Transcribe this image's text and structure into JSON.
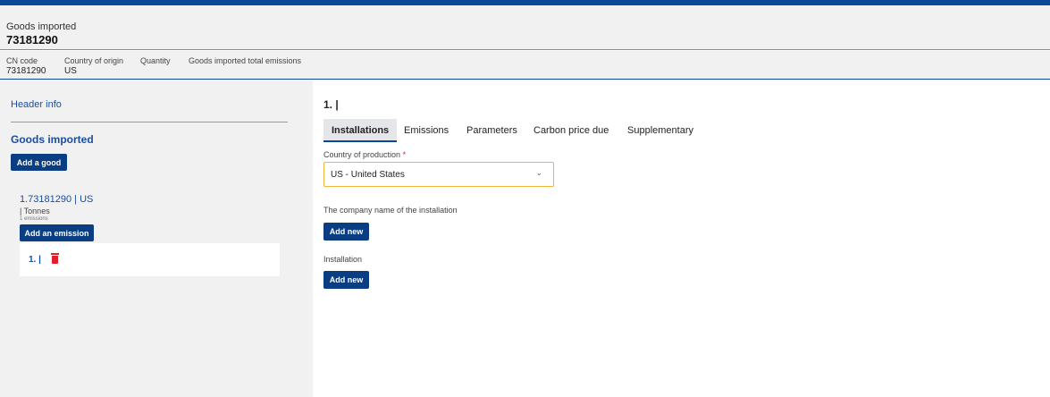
{
  "header": {
    "label": "Goods imported",
    "value": "73181290"
  },
  "summary": {
    "cn_code_label": "CN code",
    "cn_code_value": "73181290",
    "origin_label": "Country of origin",
    "origin_value": "US",
    "quantity_label": "Quantity",
    "total_emissions_label": "Goods imported total emissions"
  },
  "sidebar": {
    "header_info": "Header info",
    "goods_title": "Goods imported",
    "add_good": "Add a good",
    "good_item": {
      "name": "1.73181290 | US",
      "unit": "| Tonnes",
      "count": "1 emissions"
    },
    "add_emission": "Add an emission",
    "emission_item": {
      "label": "1. |"
    }
  },
  "main": {
    "title": "1. |",
    "tabs": [
      {
        "label": "Installations"
      },
      {
        "label": "Emissions"
      },
      {
        "label": "Parameters"
      },
      {
        "label": "Carbon price due"
      },
      {
        "label": "Supplementary"
      }
    ],
    "country_label": "Country of production",
    "required_mark": "*",
    "country_value": "US - United States",
    "chevron": "⌄",
    "company_label": "The company name of the installation",
    "add_new_1": "Add new",
    "installation_label": "Installation",
    "add_new_2": "Add new"
  },
  "colors": {
    "primary": "#0a4797",
    "button": "#0a3d82",
    "link": "#1a4ea0",
    "danger": "#e01e26",
    "focus": "#f0b43a"
  },
  "icons": {
    "delete": "trash-icon",
    "dropdown": "chevron-down-icon"
  }
}
